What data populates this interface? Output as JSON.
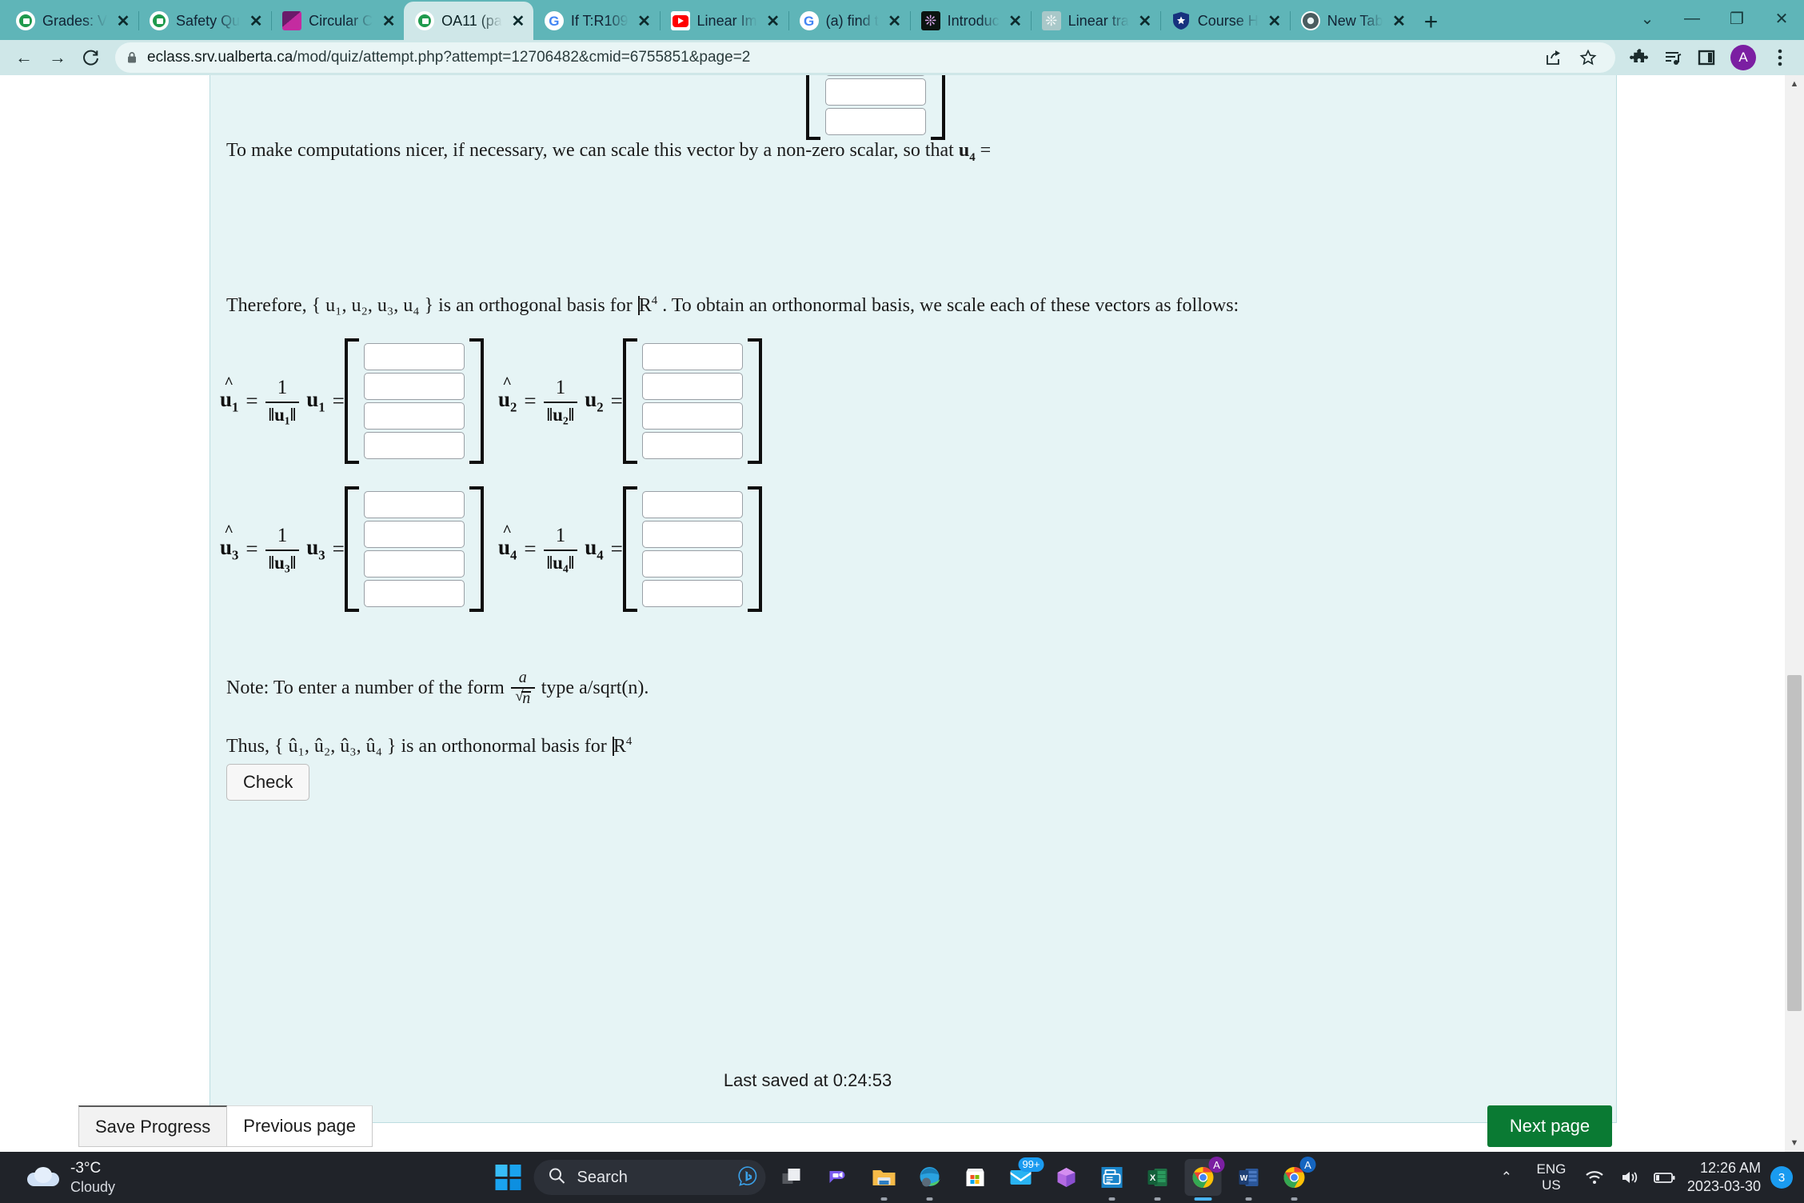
{
  "browser": {
    "tabs": [
      {
        "title": "Grades: V",
        "favicon": "eclass-icon",
        "active": false
      },
      {
        "title": "Safety Qu",
        "favicon": "eclass-icon",
        "active": false
      },
      {
        "title": "Circular C",
        "favicon": "purple-square-icon",
        "active": false
      },
      {
        "title": "OA11 (pa",
        "favicon": "eclass-icon",
        "active": true
      },
      {
        "title": "If T:R109",
        "favicon": "google-icon",
        "active": false
      },
      {
        "title": "Linear Im",
        "favicon": "youtube-icon",
        "active": false
      },
      {
        "title": "(a) find t",
        "favicon": "google-icon",
        "active": false
      },
      {
        "title": "Introduc",
        "favicon": "openai-icon",
        "active": false
      },
      {
        "title": "Linear tra",
        "favicon": "openai-icon",
        "active": false
      },
      {
        "title": "Course H",
        "favicon": "shield-star-icon",
        "active": false
      },
      {
        "title": "New Tab",
        "favicon": "chrome-icon",
        "active": false
      }
    ],
    "new_tab_label": "+",
    "close_label": "✕",
    "window_controls": {
      "minimize_all": "⌄",
      "minimize": "—",
      "maximize": "❐",
      "close": "✕"
    },
    "nav": {
      "back": "←",
      "forward": "→",
      "reload": "C"
    },
    "url_host": "eclass.srv.ualberta.ca",
    "url_path": "/mod/quiz/attempt.php?attempt=12706482&cmid=6755851&page=2",
    "url_full": "eclass.srv.ualberta.ca/mod/quiz/attempt.php?attempt=12706482&cmid=6755851&page=2",
    "toolbar_icons": [
      "share-icon",
      "bookmark-star-icon",
      "extensions-puzzle-icon",
      "reading-list-icon",
      "side-panel-icon"
    ],
    "avatar_initial": "A"
  },
  "quiz": {
    "scale_note_pre": "To make computations nicer, if necessary, we can scale this vector by a non-zero scalar, so that",
    "scale_note_symbol": "u",
    "scale_note_sub": "4",
    "equals": "=",
    "therefore_pre": "Therefore,",
    "therefore_set": "{ u₁, u₂, u₃, u₄ }",
    "therefore_mid": "is an orthogonal basis for",
    "therefore_space": "R",
    "therefore_space_exp": "4",
    "therefore_post": ". To obtain an orthonormal basis, we scale each of these vectors as follows:",
    "normalizations": [
      {
        "hat": "û",
        "index": "1",
        "one": "1",
        "norm": "‖u₁‖",
        "vec": "u",
        "sub": "1"
      },
      {
        "hat": "û",
        "index": "2",
        "one": "1",
        "norm": "‖u₂‖",
        "vec": "u",
        "sub": "2"
      },
      {
        "hat": "û",
        "index": "3",
        "one": "1",
        "norm": "‖u₃‖",
        "vec": "u",
        "sub": "3"
      },
      {
        "hat": "û",
        "index": "4",
        "one": "1",
        "norm": "‖u₄‖",
        "vec": "u",
        "sub": "4"
      }
    ],
    "answer_boxes_per_vector": 4,
    "answer_values": [
      "",
      "",
      "",
      ""
    ],
    "answer_placeholder": "",
    "note_pre": "Note: To enter a number of the form",
    "note_frac_num": "a",
    "note_frac_den": "n",
    "note_post": "type  a/sqrt(n).",
    "thus_pre": "Thus,",
    "thus_set": "{ û₁, û₂, û₃, û₄ }",
    "thus_mid": "is an orthonormal basis for",
    "thus_space": "R",
    "thus_space_exp": "4",
    "check_label": "Check",
    "last_saved": "Last saved at 0:24:53",
    "save_progress_label": "Save Progress",
    "previous_page_label": "Previous page",
    "next_page_label": "Next page"
  },
  "taskbar": {
    "weather_temp": "-3°C",
    "weather_desc": "Cloudy",
    "start_label": "windows-start-icon",
    "search_placeholder": "Search",
    "apps": [
      {
        "name": "task-view-icon",
        "badge": ""
      },
      {
        "name": "teams-icon",
        "badge": ""
      },
      {
        "name": "file-explorer-icon",
        "badge": ""
      },
      {
        "name": "edge-icon",
        "badge": ""
      },
      {
        "name": "microsoft-store-icon",
        "badge": ""
      },
      {
        "name": "mail-icon",
        "badge": "99+"
      },
      {
        "name": "office-icon",
        "badge": ""
      },
      {
        "name": "print-scan-icon",
        "badge": ""
      },
      {
        "name": "excel-icon",
        "badge": ""
      },
      {
        "name": "chrome-icon",
        "badge": "A"
      },
      {
        "name": "word-icon",
        "badge": ""
      },
      {
        "name": "chrome-icon",
        "badge": "A"
      }
    ],
    "tray": {
      "chevron": "⌃",
      "lang_line1": "ENG",
      "lang_line2": "US",
      "wifi": "wifi-icon",
      "volume": "volume-icon",
      "battery": "battery-icon",
      "time": "12:26 AM",
      "date": "2023-03-30",
      "notification_count": "3"
    }
  }
}
